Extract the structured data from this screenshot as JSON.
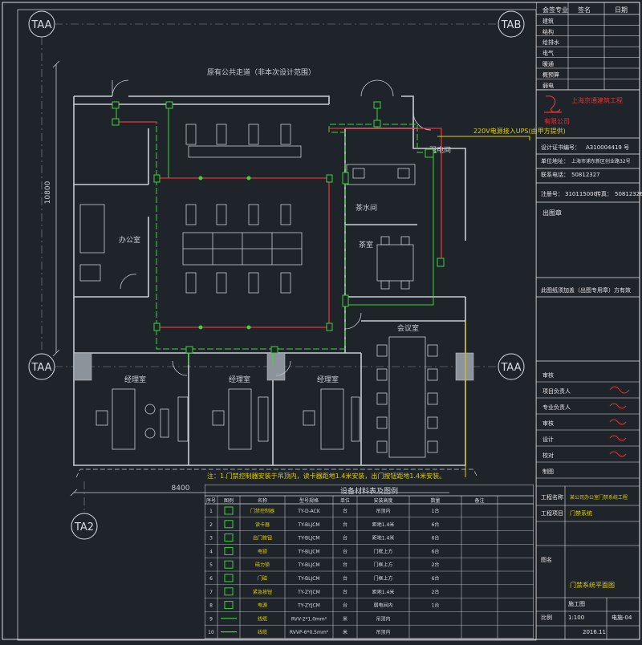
{
  "axis_labels": {
    "taa_top_left": "TAA",
    "tab_top_right": "TAB",
    "taa_mid_left": "TAA",
    "taa_mid_right": "TAA",
    "ta2_bottom": "TA2"
  },
  "dimensions": {
    "vertical": "10800",
    "horizontal": "8400"
  },
  "rooms": {
    "corridor_note": "原有公共走道（非本次设计范围）",
    "office": "办公室",
    "tea_room": "茶水间",
    "tea_room2": "茶室",
    "meeting": "会议室",
    "manager_a": "经理室",
    "manager_b": "经理室",
    "manager_c": "经理室"
  },
  "power_note": "220V电源接入UPS(由甲方提供)",
  "security_room": "弱电间",
  "note_bar": "注：1.门禁控制器安装于吊顶内，读卡器距地1.4米安装，出门按钮距地1.4米安装。",
  "legend": {
    "title": "设备材料表及图例",
    "headers": [
      "序号",
      "图例",
      "名称",
      "型号规格",
      "单位",
      "安装高度",
      "数量",
      "备注"
    ],
    "rows": [
      [
        "1",
        "",
        "门禁控制器",
        "TY-D-ACK",
        "台",
        "吊顶内",
        "1台",
        ""
      ],
      [
        "2",
        "",
        "读卡器",
        "TY-BLJCM",
        "台",
        "距地1.4米",
        "6台",
        ""
      ],
      [
        "3",
        "",
        "出门按钮",
        "TY-BLJCM",
        "台",
        "距地1.4米",
        "6台",
        ""
      ],
      [
        "4",
        "",
        "电锁",
        "TY-BLJCM",
        "台",
        "门框上方",
        "6台",
        ""
      ],
      [
        "5",
        "",
        "磁力锁",
        "TY-BLJCM",
        "台",
        "门框上方",
        "2台",
        ""
      ],
      [
        "6",
        "",
        "门磁",
        "TY-BLJCM",
        "台",
        "门框上方",
        "6台",
        ""
      ],
      [
        "7",
        "",
        "紧急按钮",
        "TY-ZYJCM",
        "台",
        "距地1.4米",
        "2台",
        ""
      ],
      [
        "8",
        "",
        "电源",
        "TY-ZYJCM",
        "台",
        "弱电间内",
        "1台",
        ""
      ],
      [
        "9",
        "",
        "线缆",
        "RVV-2*1.0mm²",
        "米",
        "吊顶内",
        "",
        ""
      ],
      [
        "10",
        "",
        "线缆",
        "RVVP-6*0.5mm²",
        "米",
        "吊顶内",
        "",
        ""
      ]
    ]
  },
  "title_block": {
    "header": [
      "会签专业",
      "签名",
      "日期"
    ],
    "sign_rows": [
      "建筑",
      "结构",
      "给排水",
      "电气",
      "暖通",
      "概预算",
      "弱电"
    ],
    "company_line1": "上海京通建筑工程",
    "company_line2": "有限公司",
    "cert_label": "设计证书编号：",
    "cert_no": "A310004419 号",
    "address_label": "单位地址：",
    "address": "上海市浦东新区创业路32号",
    "phone_label": "联系电话：",
    "phone": "50812327",
    "reg_label": "注册号：",
    "reg": "310115000",
    "reg2_label": "传真：",
    "reg2": "50812326",
    "stamp_label": "出图章",
    "approval": "此图纸须加盖（出图专用章）方有效",
    "roles": [
      "审核",
      "项目负责人",
      "专业负责人",
      "审核",
      "设计",
      "校对",
      "制图"
    ],
    "project_label": "工程名称",
    "project": "某公司办公室门禁系统工程",
    "item_label": "工程项目",
    "item": "门禁系统",
    "drawing_label": "图名",
    "drawing": "门禁系统平面图",
    "stage": "施工图",
    "scale_label": "比例",
    "scale": "1:100",
    "date": "2016.11",
    "sheet": "电施-04"
  },
  "colors": {
    "background": "#1f232a",
    "line": "#d8dde3",
    "wall": "#c9ced5",
    "green": "#3bd43b",
    "red": "#e23434",
    "yellow": "#e0d000",
    "frame": "#e6e6e6"
  }
}
